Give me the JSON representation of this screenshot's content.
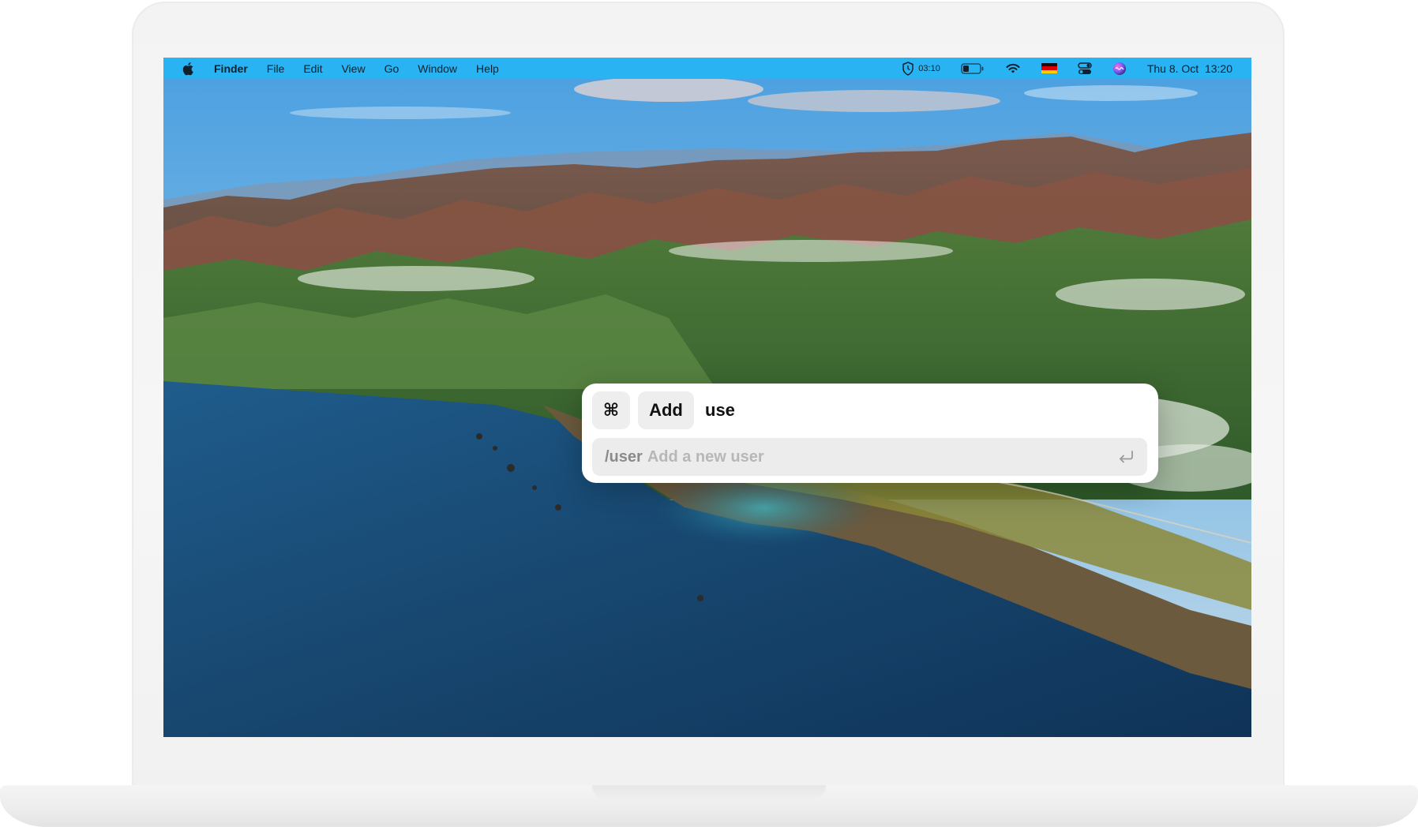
{
  "menubar": {
    "app_name": "Finder",
    "menus": [
      "File",
      "Edit",
      "View",
      "Go",
      "Window",
      "Help"
    ],
    "timer": "03:10",
    "battery_level": 0.35,
    "datetime": "Thu 8. Oct  13:20",
    "icons": [
      "apple-icon",
      "shield-timer-icon",
      "battery-icon",
      "wifi-icon",
      "german-flag-icon",
      "control-center-icon",
      "siri-icon"
    ],
    "bar_color": "#29b3f2"
  },
  "palette": {
    "modifier_key": "⌘",
    "command_chip": "Add",
    "query": "use",
    "suggestion": {
      "command": "/user",
      "description": "Add a new user"
    },
    "enter_icon": "return-icon"
  }
}
